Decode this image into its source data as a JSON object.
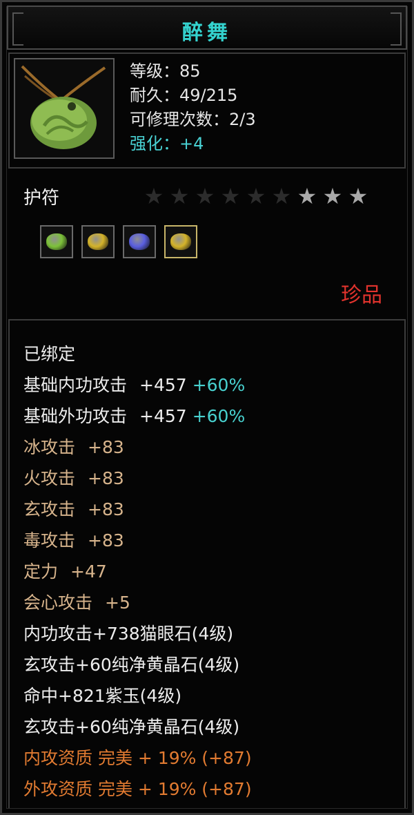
{
  "item": {
    "name": "醉舞",
    "stats": [
      {
        "text": "等级：85",
        "style": "white"
      },
      {
        "text": "耐久：49/215",
        "style": "white"
      },
      {
        "text": "可修理次数：2/3",
        "style": "white"
      },
      {
        "text": "强化：+4",
        "style": "cyan"
      }
    ],
    "type": "护符",
    "star_rating": {
      "lit": 3,
      "total": 9
    },
    "gems": [
      {
        "name": "green-gem-icon",
        "color": "#7dc23a"
      },
      {
        "name": "yellow-gem-icon",
        "color": "#d4b32a"
      },
      {
        "name": "purple-gem-icon",
        "color": "#5a5fe0"
      },
      {
        "name": "yellow-gem-icon",
        "color": "#d4b32a"
      }
    ],
    "rarity": "珍品"
  },
  "attributes": [
    {
      "label": "已绑定",
      "value": "",
      "extra": "",
      "color": "#ededed"
    },
    {
      "label": "基础内功攻击",
      "value": "+457",
      "extra": "+60%",
      "color": "#ededed"
    },
    {
      "label": "基础外功攻击",
      "value": "+457",
      "extra": "+60%",
      "color": "#ededed"
    },
    {
      "label": "冰攻击",
      "value": "+83",
      "extra": "",
      "color": "#d7b48c"
    },
    {
      "label": "火攻击",
      "value": "+83",
      "extra": "",
      "color": "#d7b48c"
    },
    {
      "label": "玄攻击",
      "value": "+83",
      "extra": "",
      "color": "#d7b48c"
    },
    {
      "label": "毒攻击",
      "value": "+83",
      "extra": "",
      "color": "#d7b48c"
    },
    {
      "label": "定力",
      "value": "+47",
      "extra": "",
      "color": "#d7b48c"
    },
    {
      "label": "会心攻击",
      "value": "+5",
      "extra": "",
      "color": "#d7b48c"
    },
    {
      "label": "内功攻击+738猫眼石(4级)",
      "value": "",
      "extra": "",
      "color": "#ededed"
    },
    {
      "label": "玄攻击+60纯净黄晶石(4级)",
      "value": "",
      "extra": "",
      "color": "#ededed"
    },
    {
      "label": "命中+821紫玉(4级)",
      "value": "",
      "extra": "",
      "color": "#ededed"
    },
    {
      "label": "玄攻击+60纯净黄晶石(4级)",
      "value": "",
      "extra": "",
      "color": "#ededed"
    },
    {
      "label": "内攻资质 完美 + 19% (+87)",
      "value": "",
      "extra": "",
      "color": "#e27b31"
    },
    {
      "label": "外攻资质 完美 + 19% (+87)",
      "value": "",
      "extra": "",
      "color": "#e27b31"
    }
  ]
}
